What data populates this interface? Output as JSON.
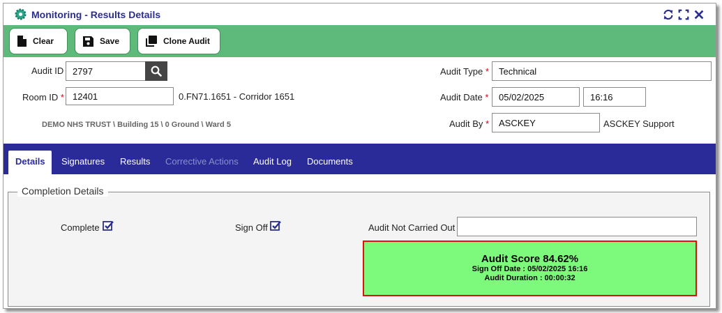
{
  "window": {
    "title": "Monitoring - Results Details",
    "controls": [
      "refresh-icon",
      "expand-icon",
      "close-icon"
    ]
  },
  "toolbar": {
    "clear_label": "Clear",
    "save_label": "Save",
    "clone_label": "Clone Audit"
  },
  "form": {
    "audit_id_label": "Audit ID",
    "audit_id_value": "2797",
    "room_id_label": "Room ID",
    "room_id_value": "12401",
    "room_description": "0.FN71.1651 - Corridor 1651",
    "location_path": "DEMO NHS TRUST \\ Building 15 \\ 0 Ground \\ Ward 5",
    "audit_type_label": "Audit Type",
    "audit_type_value": "Technical",
    "audit_date_label": "Audit Date",
    "audit_date_value": "05/02/2025",
    "audit_time_value": "16:16",
    "audit_by_label": "Audit By",
    "audit_by_value": "ASCKEY",
    "audit_by_name": "ASCKEY Support",
    "required_marker": "*"
  },
  "tabs": [
    {
      "label": "Details",
      "active": true,
      "enabled": true
    },
    {
      "label": "Signatures",
      "active": false,
      "enabled": true
    },
    {
      "label": "Results",
      "active": false,
      "enabled": true
    },
    {
      "label": "Corrective Actions",
      "active": false,
      "enabled": false
    },
    {
      "label": "Audit Log",
      "active": false,
      "enabled": true
    },
    {
      "label": "Documents",
      "active": false,
      "enabled": true
    }
  ],
  "completion": {
    "legend": "Completion Details",
    "complete_label": "Complete",
    "complete_checked": true,
    "signoff_label": "Sign Off",
    "signoff_checked": true,
    "not_carried_out_label": "Audit Not Carried Out",
    "not_carried_out_value": "",
    "score_title": "Audit Score 84.62%",
    "signoff_date_line": "Sign Off Date : 05/02/2025 16:16",
    "duration_line": "Audit Duration : 00:00:32"
  },
  "colors": {
    "title_text": "#2b2e8f",
    "toolbar_bg": "#5dba7a",
    "tabbar_bg": "#2a2b99",
    "required": "#d0021b",
    "score_bg": "#7dfa7b",
    "score_border": "#e0100f"
  }
}
